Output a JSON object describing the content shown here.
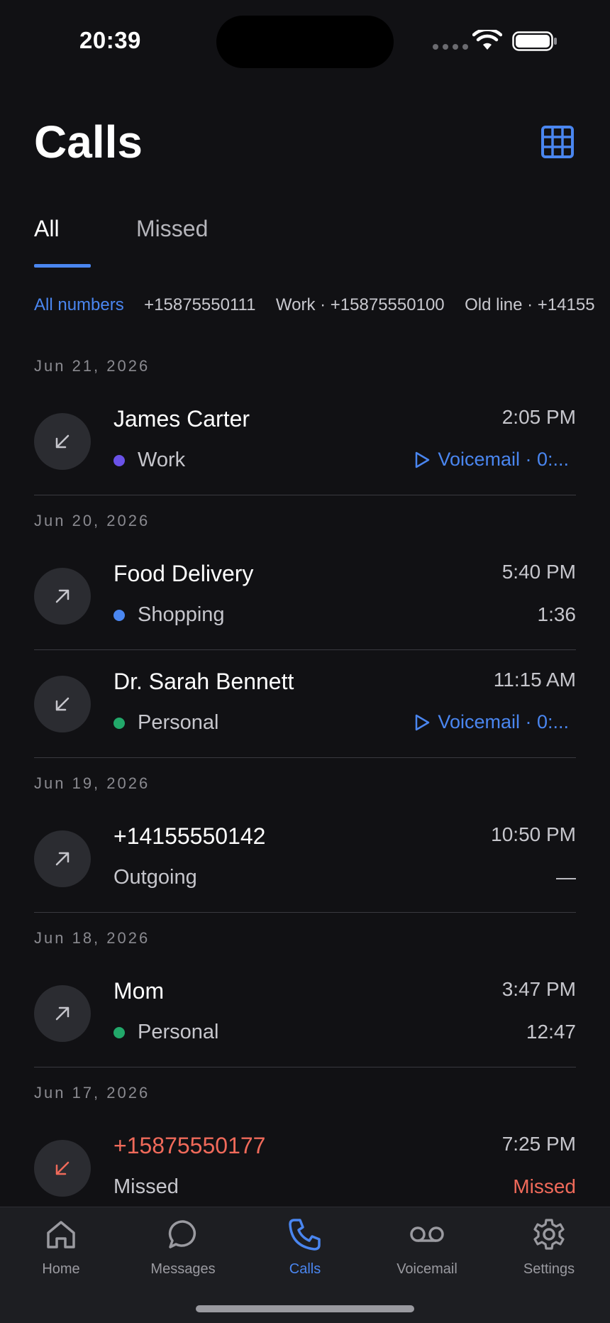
{
  "status": {
    "time": "20:39"
  },
  "header": {
    "title": "Calls"
  },
  "tabs": [
    {
      "label": "All",
      "active": true
    },
    {
      "label": "Missed",
      "active": false
    }
  ],
  "filters": [
    {
      "label": "All numbers",
      "active": true
    },
    {
      "label": "+15875550111"
    },
    {
      "label": "Work · +15875550100"
    },
    {
      "label": "Old line · +14155"
    }
  ],
  "groups": [
    {
      "date": "Jun 21, 2026",
      "calls": [
        {
          "name": "James Carter",
          "direction": "incoming",
          "tag": "Work",
          "tag_color": "#6a52e8",
          "time": "2:05 PM",
          "meta": "Voicemail · 0:...",
          "meta_type": "voicemail"
        }
      ]
    },
    {
      "date": "Jun 20, 2026",
      "calls": [
        {
          "name": "Food Delivery",
          "direction": "outgoing",
          "tag": "Shopping",
          "tag_color": "#4a86f0",
          "time": "5:40 PM",
          "meta": "1:36",
          "meta_type": "duration"
        },
        {
          "name": "Dr. Sarah Bennett",
          "direction": "incoming",
          "tag": "Personal",
          "tag_color": "#22a86a",
          "time": "11:15 AM",
          "meta": "Voicemail · 0:...",
          "meta_type": "voicemail"
        }
      ]
    },
    {
      "date": "Jun 19, 2026",
      "calls": [
        {
          "name": "+14155550142",
          "direction": "outgoing",
          "tag": "Outgoing",
          "tag_color": "",
          "time": "10:50 PM",
          "meta": "—",
          "meta_type": "duration"
        }
      ]
    },
    {
      "date": "Jun 18, 2026",
      "calls": [
        {
          "name": "Mom",
          "direction": "outgoing",
          "tag": "Personal",
          "tag_color": "#22a86a",
          "time": "3:47 PM",
          "meta": "12:47",
          "meta_type": "duration"
        }
      ]
    },
    {
      "date": "Jun 17, 2026",
      "calls": [
        {
          "name": "+15875550177",
          "direction": "missed",
          "tag": "Missed",
          "tag_color": "",
          "time": "7:25 PM",
          "meta": "Missed",
          "meta_type": "missed"
        }
      ]
    }
  ],
  "tabbar": [
    {
      "label": "Home",
      "icon": "home-icon",
      "active": false
    },
    {
      "label": "Messages",
      "icon": "message-icon",
      "active": false
    },
    {
      "label": "Calls",
      "icon": "phone-icon",
      "active": true
    },
    {
      "label": "Voicemail",
      "icon": "voicemail-icon",
      "active": false
    },
    {
      "label": "Settings",
      "icon": "gear-icon",
      "active": false
    }
  ],
  "colors": {
    "accent": "#4a86f0",
    "missed": "#f06a5a",
    "background": "#111114"
  }
}
